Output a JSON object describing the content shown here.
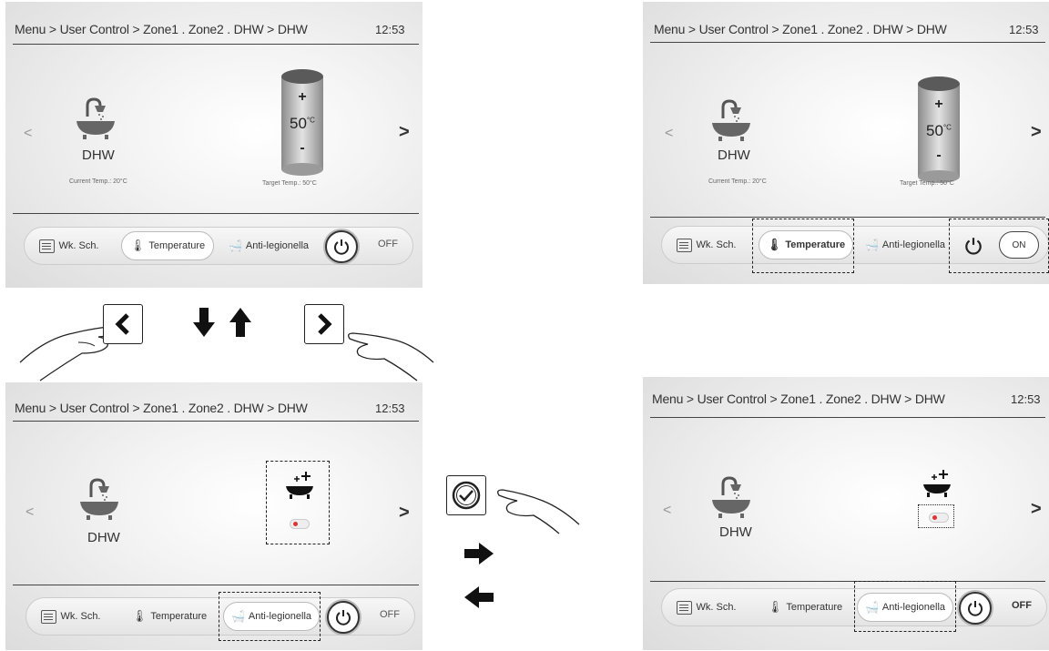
{
  "screens": [
    {
      "breadcrumb": "Menu > User Control > Zone1 . Zone2 . DHW > DHW",
      "time": "12:53",
      "nav_left": "<",
      "nav_right": ">",
      "dhw_label": "DHW",
      "current_temp": "Current Temp.: 20°C",
      "target_temp": "Target Temp.: 50°C",
      "tank_plus": "+",
      "tank_value": "50",
      "tank_unit": "°C",
      "tank_minus": "-",
      "tabs": [
        "Wk. Sch.",
        "Temperature",
        "Anti-legionella"
      ],
      "power_state": "OFF"
    },
    {
      "breadcrumb": "Menu > User Control > Zone1 . Zone2 . DHW > DHW",
      "time": "12:53",
      "nav_left": "<",
      "nav_right": ">",
      "dhw_label": "DHW",
      "current_temp": "Current Temp.: 20°C",
      "target_temp": "Target Temp.: 50°C",
      "tank_plus": "+",
      "tank_value": "50",
      "tank_unit": "°C",
      "tank_minus": "-",
      "tabs": [
        "Wk. Sch.",
        "Temperature",
        "Anti-legionella"
      ],
      "power_state": "ON"
    },
    {
      "breadcrumb": "Menu > User Control > Zone1 . Zone2 . DHW > DHW",
      "time": "12:53",
      "nav_left": "<",
      "nav_right": ">",
      "dhw_label": "DHW",
      "tabs": [
        "Wk. Sch.",
        "Temperature",
        "Anti-legionella"
      ],
      "power_state": "OFF"
    },
    {
      "breadcrumb": "Menu > User Control > Zone1 . Zone2 . DHW > DHW",
      "time": "12:53",
      "nav_left": "<",
      "nav_right": ">",
      "dhw_label": "DHW",
      "tabs": [
        "Wk. Sch.",
        "Temperature",
        "Anti-legionella"
      ],
      "power_state": "OFF"
    }
  ],
  "icons": {
    "shower_bath": "shower-bathtub-icon",
    "schedule": "schedule-list-icon",
    "thermometer": "thermometer-icon",
    "anti_legionella": "bathtub-sparkle-icon",
    "power": "power-icon",
    "confirm": "checkmark-circle-icon",
    "hand": "pointing-hand-icon"
  },
  "colors": {
    "screen_bg": "#e6e6e6",
    "tank_cap": "#5a5a5a",
    "toggle_dot": "#dd3333"
  }
}
